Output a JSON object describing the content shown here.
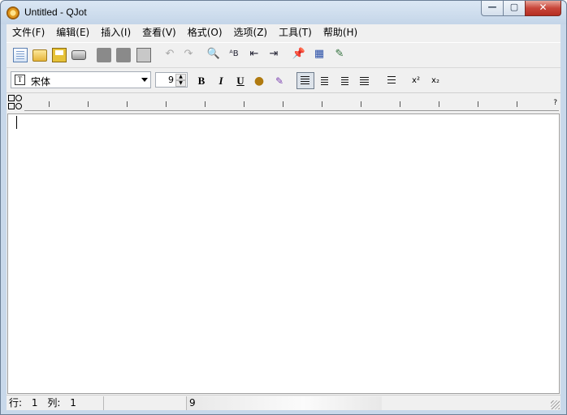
{
  "window": {
    "title": "Untitled - QJot",
    "minimize_glyph": "—",
    "maximize_glyph": "▢",
    "close_glyph": "✕"
  },
  "menu": {
    "items": [
      {
        "label": "文件(F)"
      },
      {
        "label": "编辑(E)"
      },
      {
        "label": "插入(I)"
      },
      {
        "label": "查看(V)"
      },
      {
        "label": "格式(O)"
      },
      {
        "label": "选项(Z)"
      },
      {
        "label": "工具(T)"
      },
      {
        "label": "帮助(H)"
      }
    ]
  },
  "toolbar": {
    "undo_glyph": "↶",
    "redo_glyph": "↷",
    "find_glyph": "🔍",
    "replace_glyph": "ᴬB",
    "indent_less_glyph": "⇤",
    "indent_more_glyph": "⇥",
    "pin_glyph": "📌",
    "calendar_glyph": "▦",
    "magic_glyph": "✎"
  },
  "format": {
    "font_icon": "T",
    "font_name": "宋体",
    "font_size": "9",
    "spin_up": "▲",
    "spin_down": "▼",
    "bold": "B",
    "italic": "I",
    "underline": "U",
    "color_glyph": "●",
    "highlight_glyph": "✎",
    "superscript": "x²",
    "subscript": "x₂",
    "active_alignment": "left"
  },
  "ruler": {
    "end_marker": "?"
  },
  "status": {
    "line_label": "行:",
    "line_value": "1",
    "col_label": "列:",
    "col_value": "1",
    "pane3_text": "9"
  },
  "colors": {
    "title_gradient_top": "#dbe7f4",
    "close_button": "#c8463a",
    "client_bg": "#f0f0f0",
    "editor_bg": "#ffffff"
  }
}
